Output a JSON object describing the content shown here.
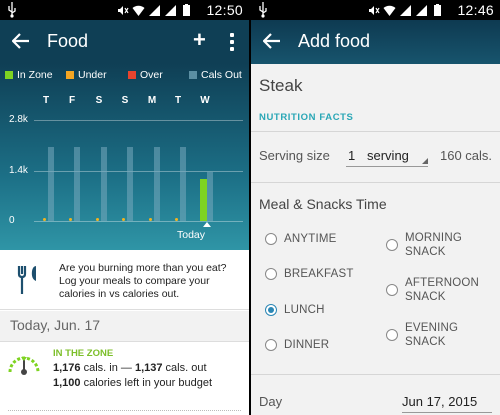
{
  "colors": {
    "appbar_dark": "#0f3f55",
    "in_zone": "#7ed321",
    "under": "#f5a623",
    "over": "#e8442e",
    "cals_out": "#5b8fa3",
    "accent": "#2aa7b6",
    "radio_selected": "#2b87b5"
  },
  "left": {
    "status": {
      "time": "12:50"
    },
    "appbar": {
      "title": "Food"
    },
    "legend": [
      {
        "label": "In Zone",
        "color": "#7ed321"
      },
      {
        "label": "Under",
        "color": "#f5a623"
      },
      {
        "label": "Over",
        "color": "#e8442e"
      },
      {
        "label": "Cals Out",
        "color": "#5b8fa3"
      }
    ],
    "chart_data": {
      "type": "bar",
      "categories": [
        "T",
        "F",
        "S",
        "S",
        "M",
        "T",
        "W"
      ],
      "y_ticks": [
        "2.8k",
        "1.4k",
        "0"
      ],
      "ylim": [
        0,
        2800
      ],
      "series": [
        {
          "name": "Cals Out",
          "values": [
            2050,
            2050,
            2050,
            2050,
            2050,
            2050,
            1350
          ]
        },
        {
          "name": "In Zone",
          "values": [
            0,
            0,
            0,
            0,
            0,
            0,
            1176
          ]
        }
      ],
      "today_label": "Today"
    },
    "tip": {
      "text": "Are you burning more than you eat? Log your meals to compare your calories in vs calories out."
    },
    "date": "Today, Jun. 17",
    "zone": {
      "label": "IN THE ZONE",
      "cals_in": "1,176",
      "cals_in_suffix": "cals. in —",
      "cals_out": "1,137",
      "cals_out_suffix": "cals. out",
      "left": "1,100",
      "left_suffix": "calories left in your budget"
    }
  },
  "right": {
    "status": {
      "time": "12:46"
    },
    "appbar": {
      "title": "Add food"
    },
    "food_name": "Steak",
    "nutrition_facts": "NUTRITION FACTS",
    "serving": {
      "label": "Serving size",
      "quantity": "1",
      "unit": "serving",
      "calories": "160 cals."
    },
    "meal_title": "Meal & Snacks Time",
    "meal_options": [
      {
        "label": "ANYTIME",
        "selected": false
      },
      {
        "label": "MORNING SNACK",
        "selected": false
      },
      {
        "label": "BREAKFAST",
        "selected": false
      },
      {
        "label": "AFTERNOON SNACK",
        "selected": false
      },
      {
        "label": "LUNCH",
        "selected": true
      },
      {
        "label": "EVENING SNACK",
        "selected": false
      },
      {
        "label": "DINNER",
        "selected": false
      }
    ],
    "day": {
      "label": "Day",
      "value": "Jun 17, 2015"
    }
  }
}
